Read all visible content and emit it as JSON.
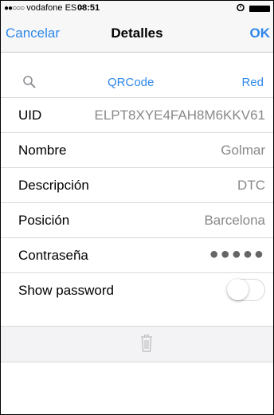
{
  "status_bar": {
    "signal_dots": "●●○○○",
    "carrier": "vodafone ES",
    "wifi_symbol": "≈",
    "time": "08:51",
    "alarm_icon": "alarm-icon",
    "battery_icon": "battery-icon"
  },
  "nav": {
    "left": "Cancelar",
    "title": "Detalles",
    "right": "OK"
  },
  "segment": {
    "search_icon": "search-icon",
    "qrcode": "QRCode",
    "red": "Red"
  },
  "rows": [
    {
      "label": "UID",
      "value": "ELPT8XYE4FAH8M6KKV61"
    },
    {
      "label": "Nombre",
      "value": "Golmar"
    },
    {
      "label": "Descripción",
      "value": "DTC"
    },
    {
      "label": "Posición",
      "value": "Barcelona"
    },
    {
      "label": "Contraseña",
      "value": "●●●●●"
    },
    {
      "label": "Show password",
      "toggle_on": false
    }
  ],
  "toolbar": {
    "trash_icon": "trash-icon"
  },
  "colors": {
    "accent": "#2f87ea",
    "separator": "#d9d9de"
  }
}
